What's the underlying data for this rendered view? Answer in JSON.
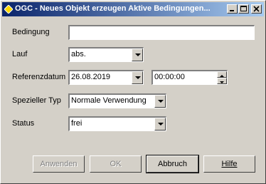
{
  "window": {
    "title": "OGC - Neues Objekt erzeugen Aktive Bedingungen..."
  },
  "form": {
    "bedingung_label": "Bedingung",
    "bedingung_value": "",
    "lauf_label": "Lauf",
    "lauf_value": "abs.",
    "referenzdatum_label": "Referenzdatum",
    "date_value": "26.08.2019",
    "time_value": "00:00:00",
    "typ_label": "Spezieller Typ",
    "typ_value": "Normale Verwendung",
    "status_label": "Status",
    "status_value": "frei"
  },
  "buttons": {
    "anwenden": "Anwenden",
    "ok": "OK",
    "abbruch": "Abbruch",
    "hilfe": "Hilfe"
  }
}
